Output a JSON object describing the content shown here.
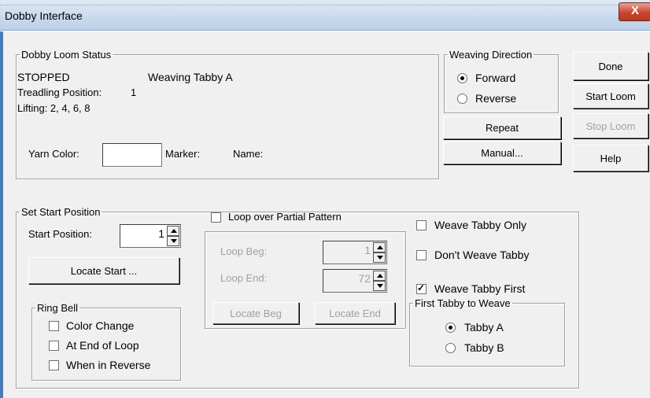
{
  "window": {
    "title": "Dobby Interface",
    "close_label": "X"
  },
  "status": {
    "legend": "Dobby Loom Status",
    "state": "STOPPED",
    "weaving": "Weaving Tabby A",
    "treadling_label": "Treadling Position:",
    "treadling_value": "1",
    "lifting": "Lifting: 2, 4, 6, 8",
    "yarn_color_label": "Yarn Color:",
    "yarn_color_value": "",
    "marker_label": "Marker:",
    "name_label": "Name:"
  },
  "direction": {
    "legend": "Weaving Direction",
    "options": [
      {
        "label": "Forward",
        "selected": true
      },
      {
        "label": "Reverse",
        "selected": false
      }
    ]
  },
  "buttons": {
    "repeat": "Repeat",
    "manual": "Manual...",
    "done": "Done",
    "start_loom": "Start Loom",
    "stop_loom": "Stop Loom",
    "help": "Help"
  },
  "start_position": {
    "legend": "Set Start Position",
    "label": "Start Position:",
    "value": "1",
    "locate_start": "Locate Start ..."
  },
  "ring_bell": {
    "legend": "Ring Bell",
    "options": [
      {
        "label": "Color Change",
        "checked": false
      },
      {
        "label": "At End of Loop",
        "checked": false
      },
      {
        "label": "When in Reverse",
        "checked": false
      }
    ]
  },
  "loop": {
    "checkbox_label": "Loop over Partial Pattern",
    "checked": false,
    "beg_label": "Loop Beg:",
    "beg_value": "1",
    "end_label": "Loop End:",
    "end_value": "72",
    "locate_beg": "Locate Beg",
    "locate_end": "Locate End"
  },
  "tabby": {
    "weave_only": {
      "label": "Weave Tabby Only",
      "checked": false
    },
    "dont_weave": {
      "label": "Don't Weave Tabby",
      "checked": false
    },
    "weave_first": {
      "label": "Weave Tabby First",
      "checked": true
    },
    "first_legend": "First Tabby to Weave",
    "options": [
      {
        "label": "Tabby A",
        "selected": true
      },
      {
        "label": "Tabby B",
        "selected": false
      }
    ]
  }
}
